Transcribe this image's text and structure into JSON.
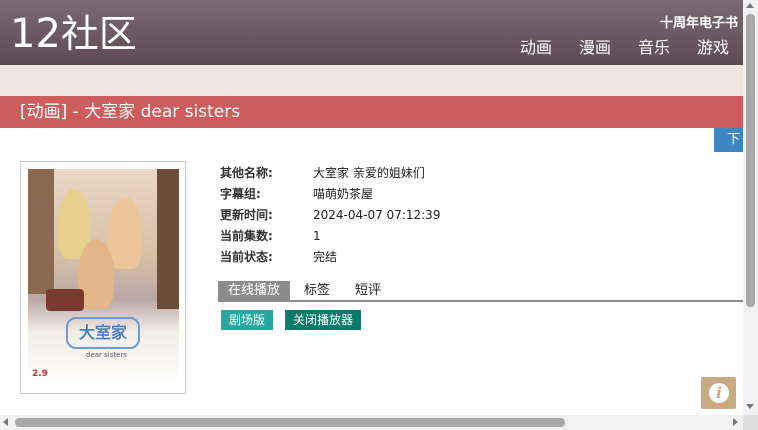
{
  "header": {
    "logo_num": "12",
    "logo_text": "社区",
    "ebook_link": "十周年电子书",
    "nav": [
      "动画",
      "漫画",
      "音乐",
      "游戏"
    ]
  },
  "page_title": "[动画] - 大室家 dear sisters",
  "download_button": "下",
  "poster": {
    "logo_text": "大室家",
    "subtitle": "dear sisters",
    "date": "2.9"
  },
  "info": {
    "rows": [
      {
        "label": "其他名称:",
        "value": "大室家 亲爱的姐妹们"
      },
      {
        "label": "字幕组:",
        "value": "喵萌奶茶屋"
      },
      {
        "label": "更新时间:",
        "value": "2024-04-07 07:12:39"
      },
      {
        "label": "当前集数:",
        "value": "1"
      },
      {
        "label": "当前状态:",
        "value": "完结"
      }
    ]
  },
  "tabs": [
    "在线播放",
    "标签",
    "短评"
  ],
  "buttons": {
    "theater": "剧场版",
    "close_player": "关闭播放器"
  },
  "info_icon": "i",
  "colors": {
    "header": "#6b5a62",
    "title_bar": "#cd5c5c",
    "download": "#3e86c2",
    "theater_btn": "#26a8a0",
    "close_btn": "#0d7a6b",
    "info_btn": "#c9ab83"
  }
}
